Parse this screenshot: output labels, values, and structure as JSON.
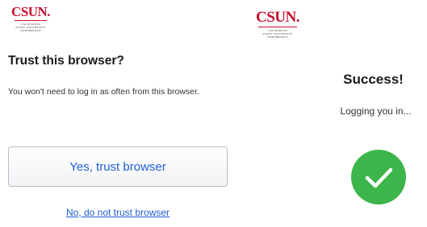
{
  "left_panel": {
    "logo": {
      "main": "CSUN.",
      "sub": [
        "CALIFORNIA",
        "STATE UNIVERSITY",
        "NORTHRIDGE"
      ]
    },
    "title": "Trust this browser?",
    "description": "You won't need to log in as often from this browser.",
    "yes_button_label": "Yes, trust browser",
    "no_link_label": "No, do not trust browser"
  },
  "right_panel": {
    "logo": {
      "main": "CSUN.",
      "sub": [
        "CALIFORNIA",
        "STATE UNIVERSITY",
        "NORTHRIDGE"
      ]
    },
    "title": "Success!",
    "status_text": "Logging you in...",
    "icon": "checkmark-circle-icon"
  },
  "colors": {
    "brand_red": "#c8102e",
    "link_blue": "#1f5fd6",
    "success_green": "#3cb54a"
  }
}
